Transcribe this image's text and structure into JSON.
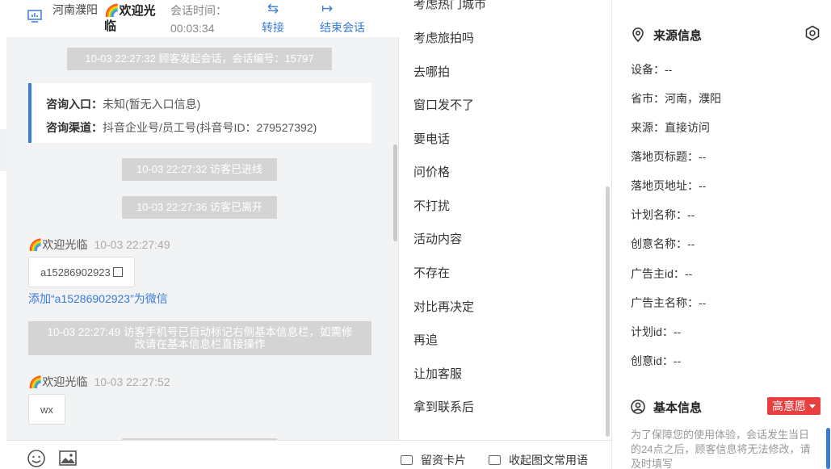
{
  "header": {
    "location": "河南濮阳",
    "visitor_name": "🌈欢迎光临",
    "session_time_label": "会话时间：",
    "session_time_value": "00:03:34",
    "transfer_label": "转接",
    "end_label": "结束会话"
  },
  "chat": {
    "sys_start": "10-03 22:27:32 顾客发起会话，会话编号：15797",
    "entry_label": "咨询入口：",
    "entry_value": "未知(暂无入口信息)",
    "channel_label": "咨询渠道：",
    "channel_value": "抖音企业号/员工号(抖音号ID：279527392)",
    "sys_enter": "10-03 22:27:32 访客已进线",
    "sys_leave": "10-03 22:27:36 访客已离开",
    "msg1_sender": "🌈欢迎光临",
    "msg1_time": "10-03 22:27:49",
    "msg1_text": "a15286902923",
    "add_wechat": "添加“a15286902923”为微信",
    "sys_phone_line1": "10-03 22:27:49 访客手机号已自动标记右侧基本信息栏，如需修",
    "sys_phone_line2": "改请在基本信息栏直接操作",
    "msg2_sender": "🌈欢迎光临",
    "msg2_time": "10-03 22:27:52",
    "msg2_text": "wx"
  },
  "replies": {
    "items": [
      "考虑热门城市",
      "考虑旅拍吗",
      "去哪拍",
      "窗口发不了",
      "要电话",
      "问价格",
      "不打扰",
      "活动内容",
      "不存在",
      "对比再决定",
      "再追",
      "让加客服",
      "拿到联系后"
    ],
    "leave_card": "留资卡片",
    "collapse": "收起图文常用语"
  },
  "info": {
    "source_title": "来源信息",
    "fields": [
      {
        "label": "设备：",
        "value": "--"
      },
      {
        "label": "省市：",
        "value": "河南，濮阳"
      },
      {
        "label": "来源：",
        "value": "直接访问"
      },
      {
        "label": "落地页标题：",
        "value": "--"
      },
      {
        "label": "落地页地址：",
        "value": "--"
      },
      {
        "label": "计划名称：",
        "value": "--"
      },
      {
        "label": "创意名称：",
        "value": "--"
      },
      {
        "label": "广告主id：",
        "value": "--"
      },
      {
        "label": "广告主名称：",
        "value": "--"
      },
      {
        "label": "计划id：",
        "value": "--"
      },
      {
        "label": "创意id：",
        "value": "--"
      }
    ],
    "basic_title": "基本信息",
    "intent_badge": "高意愿",
    "notice": "为了保障您的使用体验，会话发生当日的24点之后，顾客信息将无法修改，请及时填写"
  },
  "colors": {
    "accent": "#3a7bd5",
    "badge": "#e84040",
    "system_bg": "#d4d4d4"
  }
}
